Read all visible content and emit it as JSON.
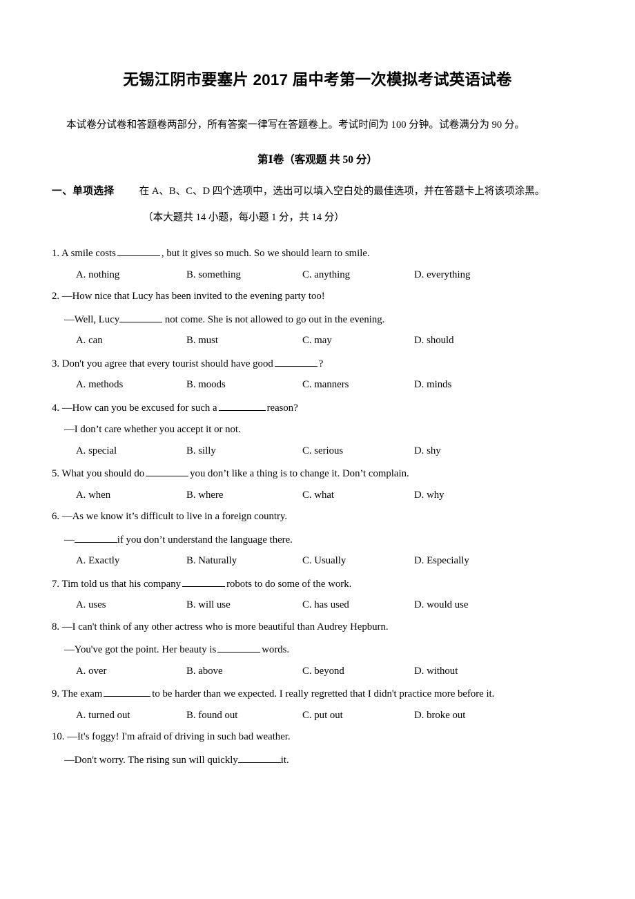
{
  "document": {
    "title": "无锡江阴市要塞片 2017 届中考第一次模拟考试英语试卷",
    "intro": "本试卷分试卷和答题卷两部分，所有答案一律写在答题卷上。考试时间为 100 分钟。试卷满分为 90 分。",
    "section_heading": "第Ⅰ卷（客观题 共 50 分）"
  },
  "part_one": {
    "label": "一、单项选择",
    "description": "在 A、B、C、D 四个选项中，选出可以填入空白处的最佳选项，并在答题卡上将该项涂黑。",
    "subtitle": "（本大题共 14 小题，每小题 1 分，共 14 分）"
  },
  "questions": [
    {
      "number": "1.",
      "stem_pre": "A smile costs",
      "stem_post": ", but it gives so much. So we should learn to smile.",
      "options": [
        "A. nothing",
        "B. something",
        "C. anything",
        "D. everything"
      ]
    },
    {
      "number": "2.",
      "dialogue_1": "—How nice that Lucy has been invited to the evening party too!",
      "dialogue_2_pre": "—Well, Lucy",
      "dialogue_2_post": "not come. She is not allowed to go out in the evening.",
      "options": [
        "A. can",
        "B. must",
        "C. may",
        "D. should"
      ]
    },
    {
      "number": "3.",
      "stem_pre": "Don't you agree that every tourist should have good",
      "stem_post": "?",
      "options": [
        "A. methods",
        "B. moods",
        "C. manners",
        "D. minds"
      ]
    },
    {
      "number": "4.",
      "dialogue_1_pre": "—How can you be excused for such a",
      "dialogue_1_post": "reason?",
      "dialogue_2": "—I don’t care whether you accept it or not.",
      "options": [
        "A. special",
        "B. silly",
        "C. serious",
        "D. shy"
      ]
    },
    {
      "number": "5.",
      "stem_pre": "What you should do",
      "stem_post": "you don’t like a thing is to change it. Don’t complain.",
      "options": [
        "A. when",
        "B. where",
        "C. what",
        "D. why"
      ]
    },
    {
      "number": "6.",
      "dialogue_1": "—As we know it’s difficult to live in a foreign country.",
      "dialogue_2_pre": "—",
      "dialogue_2_post": "if you don’t understand the language there.",
      "options": [
        "A. Exactly",
        "B. Naturally",
        "C. Usually",
        "D. Especially"
      ]
    },
    {
      "number": "7.",
      "stem_pre": "Tim told us that his company",
      "stem_post": "robots to do some of the work.",
      "options": [
        "A. uses",
        "B. will use",
        "C. has used",
        "D. would use"
      ]
    },
    {
      "number": "8.",
      "dialogue_1": "—I can't think of any other actress who is more beautiful than Audrey Hepburn.",
      "dialogue_2_pre": "—You've got the point. Her beauty is",
      "dialogue_2_post": "words.",
      "options": [
        "A. over",
        "B. above",
        "C. beyond",
        "D. without"
      ]
    },
    {
      "number": "9.",
      "stem_pre": "The exam",
      "stem_post": "to be harder than we expected. I really regretted that I didn't practice more before it.",
      "options": [
        "A. turned out",
        "B. found out",
        "C. put out",
        "D. broke out"
      ]
    },
    {
      "number": "10.",
      "dialogue_1": "—It's foggy! I'm afraid of driving in such bad weather.",
      "dialogue_2_pre": "—Don't worry. The rising sun will quickly",
      "dialogue_2_post": "it."
    }
  ]
}
